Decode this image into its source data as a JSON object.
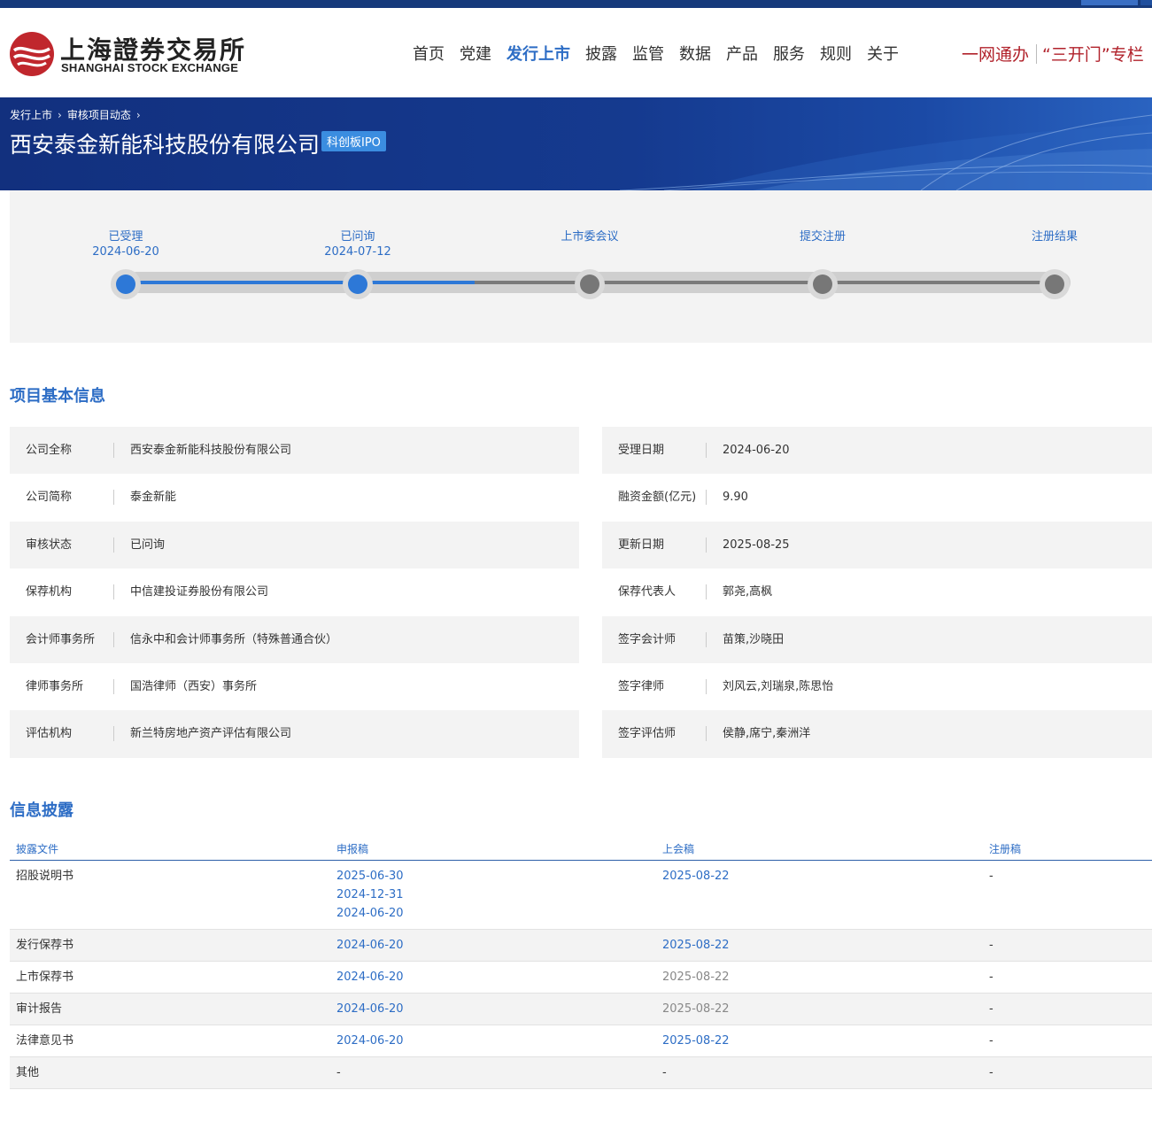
{
  "header": {
    "logo_cn": "上海證券交易所",
    "logo_en": "SHANGHAI STOCK EXCHANGE",
    "nav": [
      "首页",
      "党建",
      "发行上市",
      "披露",
      "监管",
      "数据",
      "产品",
      "服务",
      "规则",
      "关于"
    ],
    "nav_active": "发行上市",
    "quick_1": "一网通办",
    "quick_2": "“三开门”专栏"
  },
  "banner": {
    "crumb_1": "发行上市",
    "crumb_2": "审核项目动态",
    "company": "西安泰金新能科技股份有限公司",
    "board": "科创板IPO"
  },
  "progress": {
    "steps": [
      {
        "label": "已受理",
        "date": "2024-06-20"
      },
      {
        "label": "已问询",
        "date": "2024-07-12"
      },
      {
        "label": "上市委会议",
        "date": ""
      },
      {
        "label": "提交注册",
        "date": ""
      },
      {
        "label": "注册结果",
        "date": ""
      }
    ],
    "completed": 2,
    "colors": {
      "done": "#2d78d7",
      "pending": "#777777"
    }
  },
  "basic": {
    "title": "项目基本信息",
    "left": [
      {
        "k": "公司全称",
        "v": "西安泰金新能科技股份有限公司"
      },
      {
        "k": "公司简称",
        "v": "泰金新能"
      },
      {
        "k": "审核状态",
        "v": "已问询"
      },
      {
        "k": "保荐机构",
        "v": "中信建投证券股份有限公司"
      },
      {
        "k": "会计师事务所",
        "v": "信永中和会计师事务所（特殊普通合伙）"
      },
      {
        "k": "律师事务所",
        "v": "国浩律师（西安）事务所"
      },
      {
        "k": "评估机构",
        "v": "新兰特房地产资产评估有限公司"
      }
    ],
    "right": [
      {
        "k": "受理日期",
        "v": "2024-06-20"
      },
      {
        "k": "融资金额(亿元)",
        "v": "9.90"
      },
      {
        "k": "更新日期",
        "v": "2025-08-25"
      },
      {
        "k": "保荐代表人",
        "v": "郭尧,高枫"
      },
      {
        "k": "签字会计师",
        "v": "苗策,沙晓田"
      },
      {
        "k": "签字律师",
        "v": "刘风云,刘瑞泉,陈思怡"
      },
      {
        "k": "签字评估师",
        "v": "侯静,席宁,秦洲洋"
      }
    ]
  },
  "disclosure": {
    "title": "信息披露",
    "headers": [
      "披露文件",
      "申报稿",
      "上会稿",
      "注册稿"
    ],
    "rows": [
      {
        "name": "招股说明书",
        "c1": [
          "2025-06-30",
          "2024-12-31",
          "2024-06-20"
        ],
        "c1_link": true,
        "c2": [
          "2025-08-22"
        ],
        "c2_link": true,
        "c3": "-"
      },
      {
        "name": "发行保荐书",
        "c1": [
          "2024-06-20"
        ],
        "c1_link": true,
        "c2": [
          "2025-08-22"
        ],
        "c2_link": true,
        "c3": "-"
      },
      {
        "name": "上市保荐书",
        "c1": [
          "2024-06-20"
        ],
        "c1_link": true,
        "c2": [
          "2025-08-22"
        ],
        "c2_link": false,
        "c3": "-"
      },
      {
        "name": "审计报告",
        "c1": [
          "2024-06-20"
        ],
        "c1_link": true,
        "c2": [
          "2025-08-22"
        ],
        "c2_link": false,
        "c3": "-"
      },
      {
        "name": "法律意见书",
        "c1": [
          "2024-06-20"
        ],
        "c1_link": true,
        "c2": [
          "2025-08-22"
        ],
        "c2_link": true,
        "c3": "-"
      },
      {
        "name": "其他",
        "c1": [
          "-"
        ],
        "c1_link": false,
        "c2": [
          "-"
        ],
        "c2_link": false,
        "c3": "-"
      }
    ]
  }
}
